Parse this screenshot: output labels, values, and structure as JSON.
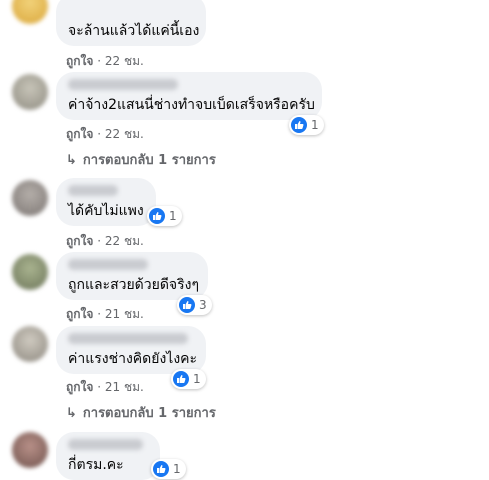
{
  "comments": [
    {
      "text": "จะล้านแล้วได้แค่นี้เอง",
      "like_label": "ถูกใจ",
      "sep": " · ",
      "time": "22 ชม.",
      "reactions": null,
      "avatar_color": "#e0b84a"
    },
    {
      "text": "ค่าจ้าง2แสนนี่ช่างทำจบเบ็ดเสร็จหรือครับ",
      "like_label": "ถูกใจ",
      "sep": " · ",
      "time": "22 ชม.",
      "reactions": "1",
      "avatar_color": "#a7a59c",
      "replies": "การตอบกลับ 1 รายการ"
    },
    {
      "text": "ได้คับไม่แพง",
      "like_label": "ถูกใจ",
      "sep": " · ",
      "time": "22 ชม.",
      "reactions": "1",
      "avatar_color": "#8f8a86"
    },
    {
      "text": "ถูกและสวยด้วยดีจริงๆ",
      "like_label": "ถูกใจ",
      "sep": " · ",
      "time": "21 ชม.",
      "reactions": "3",
      "avatar_color": "#7f8a6c"
    },
    {
      "text": "ค่าแรงช่างคิดยังไงคะ",
      "like_label": "ถูกใจ",
      "sep": " · ",
      "time": "21 ชม.",
      "reactions": "1",
      "avatar_color": "#a39f96",
      "replies": "การตอบกลับ 1 รายการ"
    },
    {
      "text": "กี่ตรม.คะ",
      "like_label": "",
      "sep": "",
      "time": "",
      "reactions": "1",
      "avatar_color": "#8a6e68"
    }
  ],
  "icons": {
    "like": "like-thumb-icon",
    "reply": "reply-arrow-icon"
  },
  "colors": {
    "accent": "#1877f2",
    "bubble": "#f0f2f5",
    "meta": "#65676b"
  }
}
